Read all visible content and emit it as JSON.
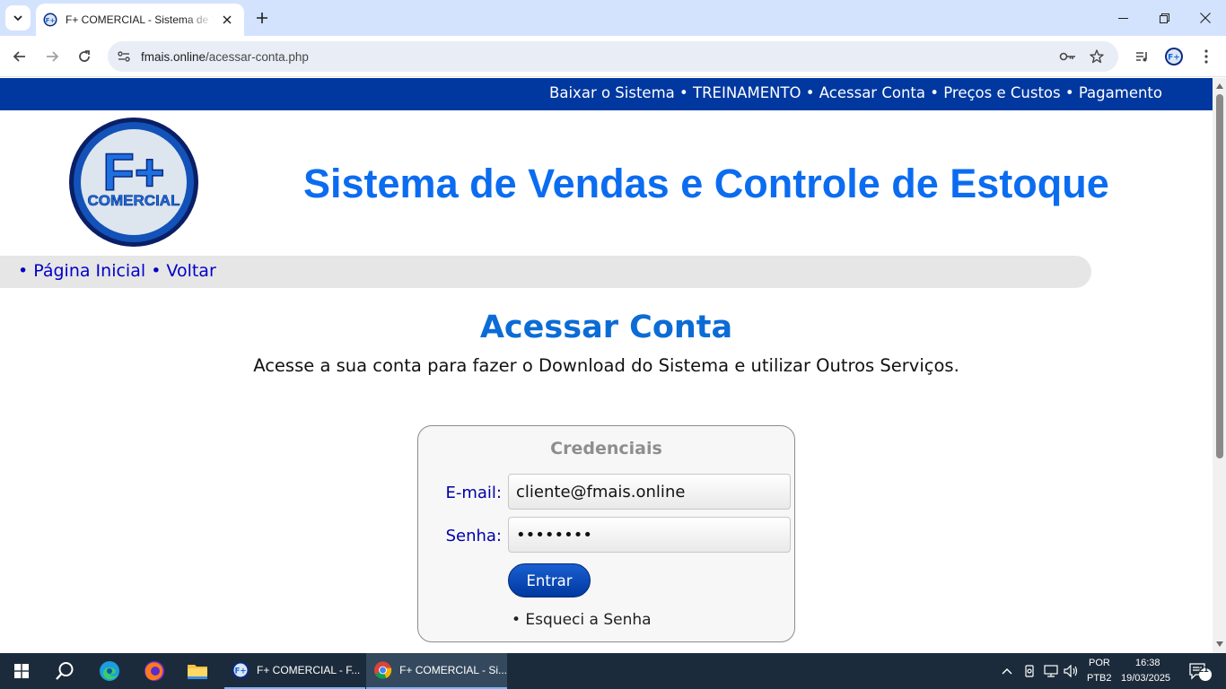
{
  "browser": {
    "tab_title": "F+ COMERCIAL - Sistema de Vendas e Controle de Estoque",
    "url_host": "fmais.online",
    "url_path": "/acessar-conta.php"
  },
  "topnav": {
    "items": [
      "Baixar o Sistema",
      "TREINAMENTO",
      "Acessar Conta",
      "Preços e Custos",
      "Pagamento"
    ],
    "separator": " • "
  },
  "logo": {
    "line1": "F+",
    "line2": "COMERCIAL"
  },
  "header": {
    "title": "Sistema de Vendas e Controle de Estoque"
  },
  "breadcrumb": {
    "home": "• Página Inicial",
    "back": "• Voltar"
  },
  "main": {
    "title": "Acessar Conta",
    "subtitle": "Acesse a sua conta para fazer o Download do Sistema e utilizar Outros Serviços."
  },
  "login": {
    "legend": "Credenciais",
    "email_label": "E-mail:",
    "email_value": "cliente@fmais.online",
    "password_label": "Senha:",
    "password_value": "********",
    "submit_label": "Entrar",
    "forgot_label": "• Esqueci a Senha"
  },
  "taskbar": {
    "apps": [
      {
        "label": "F+ COMERCIAL - F...",
        "icon": "fmais-app-icon"
      },
      {
        "label": "F+ COMERCIAL - Si...",
        "icon": "chrome-icon"
      }
    ],
    "lang_top": "POR",
    "lang_bottom": "PTB2",
    "time": "16:38",
    "date": "19/03/2025",
    "notification_count": "21"
  },
  "colors": {
    "topnav_bg": "#0038a0",
    "headline": "#0b6cf0",
    "link": "#0000c8",
    "breadbar_bg": "#e6e6e6"
  }
}
